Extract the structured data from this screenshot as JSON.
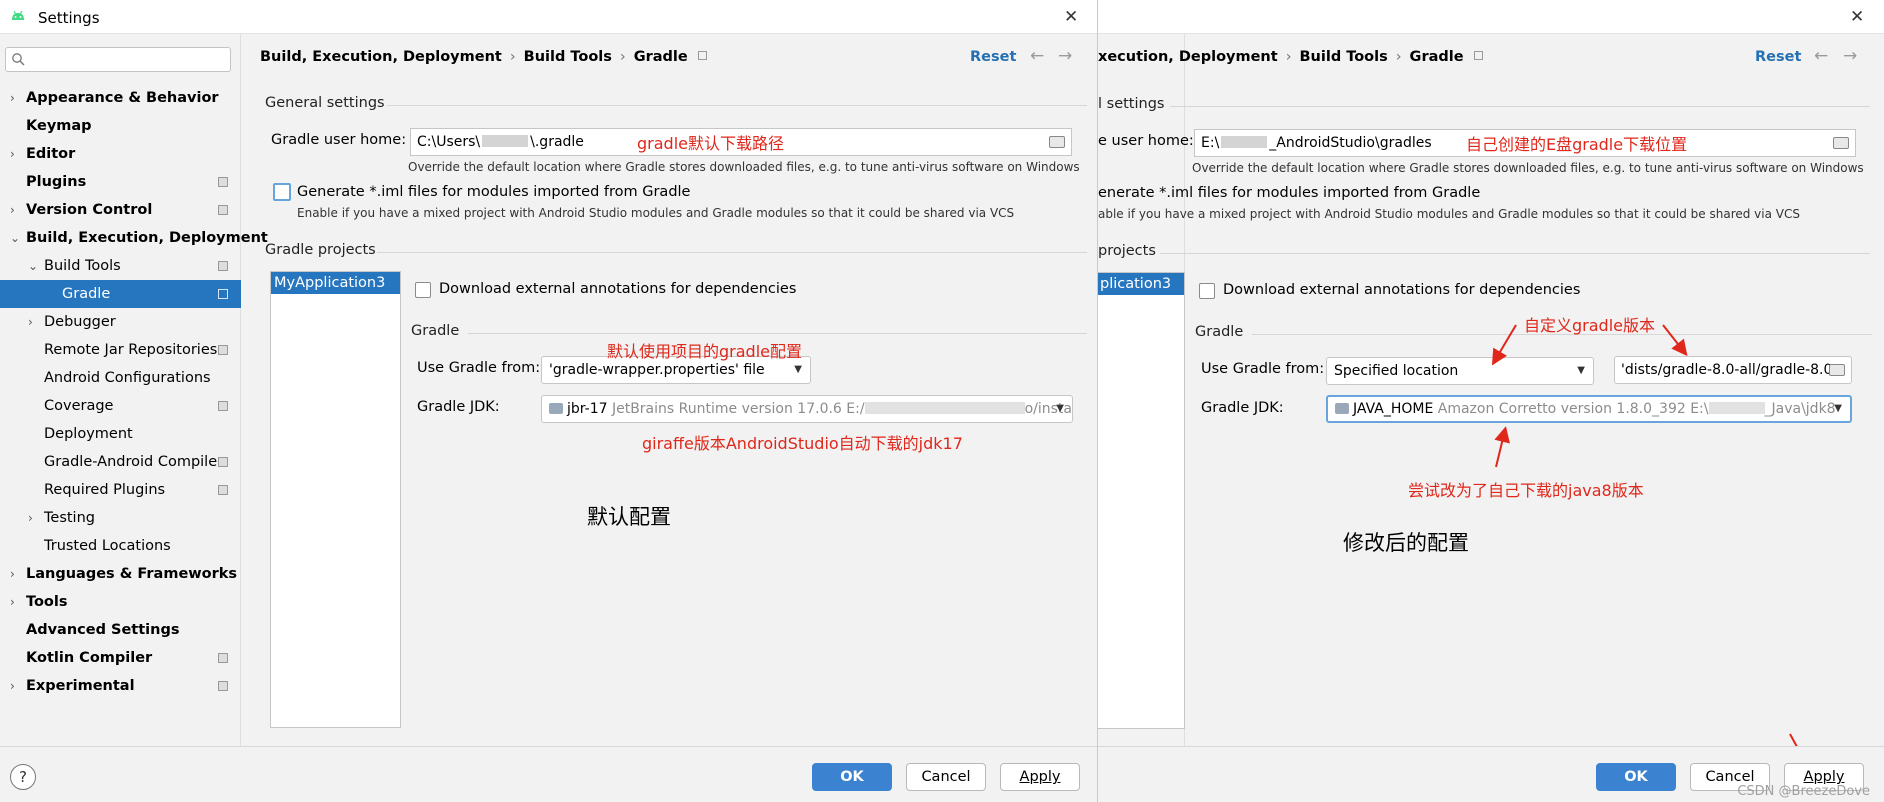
{
  "window": {
    "title": "Settings",
    "close": "✕"
  },
  "sidebar": {
    "items": [
      {
        "label": "Appearance & Behavior",
        "bold": true,
        "arrow": "›",
        "level": 0
      },
      {
        "label": "Keymap",
        "bold": true,
        "arrow": "",
        "level": 0
      },
      {
        "label": "Editor",
        "bold": true,
        "arrow": "›",
        "level": 0
      },
      {
        "label": "Plugins",
        "bold": true,
        "arrow": "",
        "level": 0,
        "gear": true
      },
      {
        "label": "Version Control",
        "bold": true,
        "arrow": "›",
        "level": 0,
        "gear": true
      },
      {
        "label": "Build, Execution, Deployment",
        "bold": true,
        "arrow": "⌄",
        "level": 0
      },
      {
        "label": "Build Tools",
        "bold": false,
        "arrow": "⌄",
        "level": 1,
        "gear": true
      },
      {
        "label": "Gradle",
        "bold": false,
        "arrow": "",
        "level": 2,
        "gear": true,
        "selected": true
      },
      {
        "label": "Debugger",
        "bold": false,
        "arrow": "›",
        "level": 1
      },
      {
        "label": "Remote Jar Repositories",
        "bold": false,
        "arrow": "",
        "level": 1,
        "gear": true
      },
      {
        "label": "Android Configurations",
        "bold": false,
        "arrow": "",
        "level": 1
      },
      {
        "label": "Coverage",
        "bold": false,
        "arrow": "",
        "level": 1,
        "gear": true
      },
      {
        "label": "Deployment",
        "bold": false,
        "arrow": "",
        "level": 1
      },
      {
        "label": "Gradle-Android Compiler",
        "bold": false,
        "arrow": "",
        "level": 1,
        "gear": true
      },
      {
        "label": "Required Plugins",
        "bold": false,
        "arrow": "",
        "level": 1,
        "gear": true
      },
      {
        "label": "Testing",
        "bold": false,
        "arrow": "›",
        "level": 1
      },
      {
        "label": "Trusted Locations",
        "bold": false,
        "arrow": "",
        "level": 1
      },
      {
        "label": "Languages & Frameworks",
        "bold": true,
        "arrow": "›",
        "level": 0
      },
      {
        "label": "Tools",
        "bold": true,
        "arrow": "›",
        "level": 0
      },
      {
        "label": "Advanced Settings",
        "bold": true,
        "arrow": "",
        "level": 0
      },
      {
        "label": "Kotlin Compiler",
        "bold": true,
        "arrow": "",
        "level": 0,
        "gear": true
      },
      {
        "label": "Experimental",
        "bold": true,
        "arrow": "›",
        "level": 0,
        "gear": true
      }
    ]
  },
  "left": {
    "breadcrumb": [
      "Build, Execution, Deployment",
      "Build Tools",
      "Gradle"
    ],
    "reset": "Reset",
    "general_settings": "General settings",
    "gradle_user_home_label": "Gradle user home:",
    "gradle_user_home_value": "C:\\Users\\",
    "gradle_user_home_value_end": "\\.gradle",
    "override_hint": "Override the default location where Gradle stores downloaded files, e.g. to tune anti-virus software on Windows",
    "generate_iml": "Generate *.iml files for modules imported from Gradle",
    "generate_iml_hint": "Enable if you have a mixed project with Android Studio modules and Gradle modules so that it could be shared via VCS",
    "gradle_projects": "Gradle projects",
    "project_item": "MyApplication3",
    "download_annotations": "Download external annotations for dependencies",
    "gradle_section": "Gradle",
    "use_gradle_from_label": "Use Gradle from:",
    "use_gradle_from_value": "'gradle-wrapper.properties' file",
    "gradle_jdk_label": "Gradle JDK:",
    "gradle_jdk_name": "jbr-17",
    "gradle_jdk_detail": "JetBrains Runtime version 17.0.6 E:/",
    "gradle_jdk_tail": "o/insta",
    "note_home": "gradle默认下载路径",
    "note_default_cfg": "默认使用项目的gradle配置",
    "note_jdk": "giraffe版本AndroidStudio自动下载的jdk17",
    "caption": "默认配置"
  },
  "right": {
    "breadcrumb_first": "xecution, Deployment",
    "breadcrumb": [
      "Build Tools",
      "Gradle"
    ],
    "reset": "Reset",
    "general_settings": "l settings",
    "gradle_user_home_label": "e user home:",
    "gradle_user_home_value": "E:\\",
    "gradle_user_home_value_end": "_AndroidStudio\\gradles",
    "override_hint": "Override the default location where Gradle stores downloaded files, e.g. to tune anti-virus software on Windows",
    "generate_iml": "enerate *.iml files for modules imported from Gradle",
    "generate_iml_hint": "able if you have a mixed project with Android Studio modules and Gradle modules so that it could be shared via VCS",
    "gradle_projects": "projects",
    "project_item": "plication3",
    "download_annotations": "Download external annotations for dependencies",
    "gradle_section": "Gradle",
    "use_gradle_from_label": "Use Gradle from:",
    "use_gradle_from_value": "Specified location",
    "gradle_location": "'dists/gradle-8.0-all/gradle-8.0",
    "gradle_jdk_label": "Gradle JDK:",
    "gradle_jdk_name": "JAVA_HOME",
    "gradle_jdk_detail": "Amazon Corretto version 1.8.0_392 E:\\",
    "gradle_jdk_tail": "_Java\\jdk8",
    "note_home": "自己创建的E盘gradle下载位置",
    "note_custom_version": "自定义gradle版本",
    "note_java8": "尝试改为了自己下载的java8版本",
    "caption": "修改后的配置"
  },
  "footer": {
    "ok": "OK",
    "cancel": "Cancel",
    "apply": "Apply",
    "help": "?"
  },
  "watermark": "CSDN @BreezeDove",
  "colors": {
    "accent": "#2675bf",
    "annotation": "#e0271b",
    "link": "#2470b3"
  }
}
